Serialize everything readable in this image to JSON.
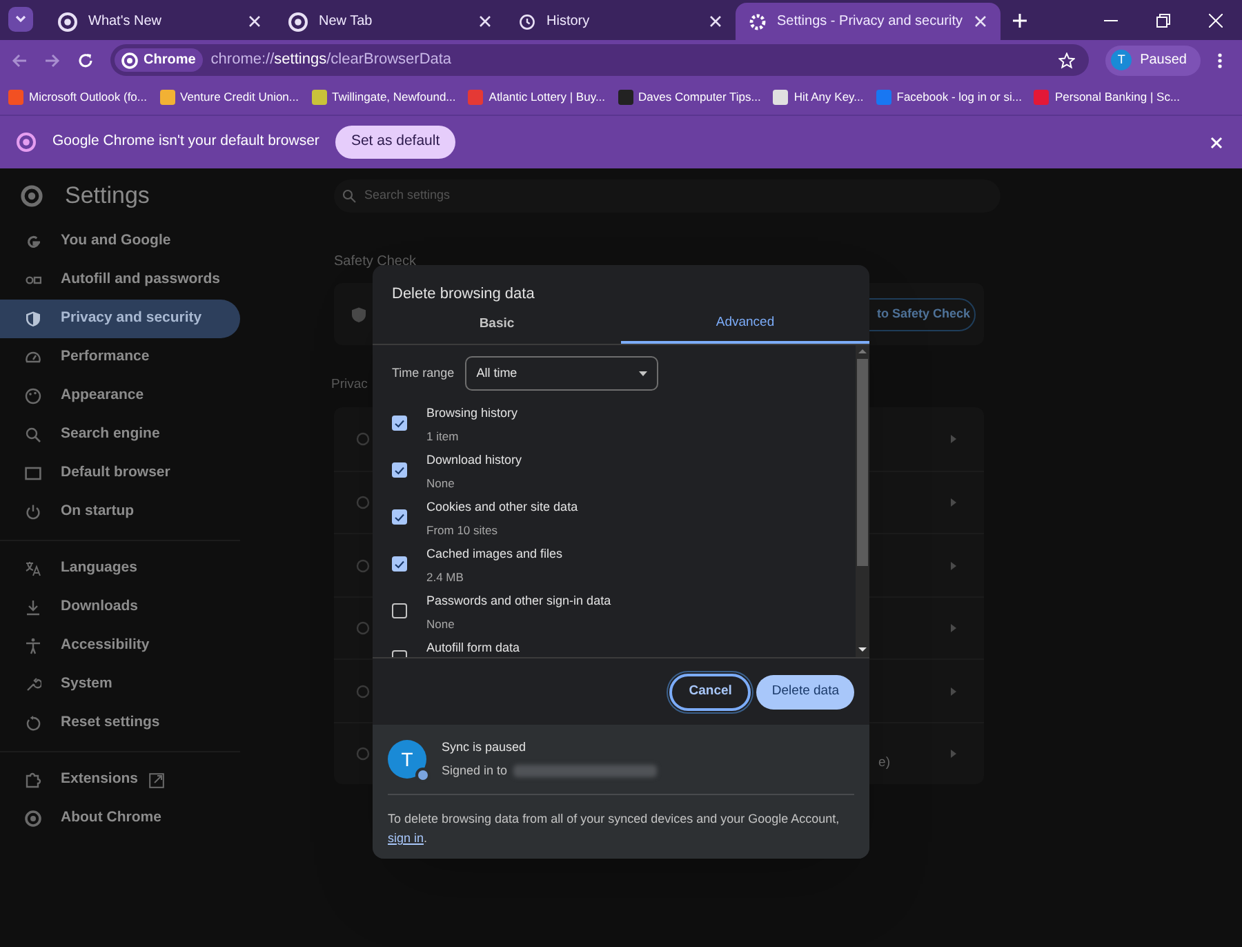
{
  "tabs": [
    {
      "title": "What's New",
      "selected": false
    },
    {
      "title": "New Tab",
      "selected": false
    },
    {
      "title": "History",
      "selected": false
    },
    {
      "title": "Settings - Privacy and security",
      "selected": true
    }
  ],
  "toolbar": {
    "chip": "Chrome",
    "url_prefix": "chrome://",
    "url_host": "settings",
    "url_path": "/clearBrowserData",
    "profile_initial": "T",
    "profile_label": "Paused"
  },
  "bookmarks": [
    {
      "title": "Microsoft Outlook (fo...",
      "color": "#f25022"
    },
    {
      "title": "Venture Credit Union...",
      "color": "#f2b134"
    },
    {
      "title": "Twillingate, Newfound...",
      "color": "#c9c23a"
    },
    {
      "title": "Atlantic Lottery | Buy...",
      "color": "#e53935"
    },
    {
      "title": "Daves Computer Tips...",
      "color": "#222222"
    },
    {
      "title": "Hit Any Key...",
      "color": "#e0e0e0"
    },
    {
      "title": "Facebook - log in or si...",
      "color": "#1877f2"
    },
    {
      "title": "Personal Banking | Sc...",
      "color": "#e31837"
    }
  ],
  "infobar": {
    "message": "Google Chrome isn't your default browser",
    "button": "Set as default"
  },
  "sidebar": {
    "title": "Settings",
    "groups": [
      [
        {
          "label": "You and Google",
          "selected": false
        },
        {
          "label": "Autofill and passwords",
          "selected": false
        },
        {
          "label": "Privacy and security",
          "selected": true
        },
        {
          "label": "Performance",
          "selected": false
        },
        {
          "label": "Appearance",
          "selected": false
        },
        {
          "label": "Search engine",
          "selected": false
        },
        {
          "label": "Default browser",
          "selected": false
        },
        {
          "label": "On startup",
          "selected": false
        }
      ],
      [
        {
          "label": "Languages",
          "selected": false
        },
        {
          "label": "Downloads",
          "selected": false
        },
        {
          "label": "Accessibility",
          "selected": false
        },
        {
          "label": "System",
          "selected": false
        },
        {
          "label": "Reset settings",
          "selected": false
        }
      ],
      [
        {
          "label": "Extensions",
          "selected": false,
          "external": true
        },
        {
          "label": "About Chrome",
          "selected": false
        }
      ]
    ]
  },
  "main": {
    "search_placeholder": "Search settings",
    "safety_heading": "Safety Check",
    "safety_button": "to Safety Check",
    "privacy_heading": "Privac",
    "privacy_row_count_note": "e)"
  },
  "dialog": {
    "title": "Delete browsing data",
    "tabs": [
      {
        "label": "Basic",
        "selected": false
      },
      {
        "label": "Advanced",
        "selected": true
      }
    ],
    "time_range_label": "Time range",
    "time_range_value": "All time",
    "items": [
      {
        "label": "Browsing history",
        "detail": "1 item",
        "checked": true
      },
      {
        "label": "Download history",
        "detail": "None",
        "checked": true
      },
      {
        "label": "Cookies and other site data",
        "detail": "From 10 sites",
        "checked": true
      },
      {
        "label": "Cached images and files",
        "detail": "2.4 MB",
        "checked": true
      },
      {
        "label": "Passwords and other sign-in data",
        "detail": "None",
        "checked": false
      },
      {
        "label": "Autofill form data",
        "checked": false
      }
    ],
    "buttons": {
      "cancel": "Cancel",
      "confirm": "Delete data"
    },
    "sync": {
      "initial": "T",
      "status": "Sync is paused",
      "signed_in": "Signed in to",
      "note": "To delete browsing data from all of your synced devices and your Google Account,",
      "link": "sign in",
      "note_end": "."
    }
  }
}
